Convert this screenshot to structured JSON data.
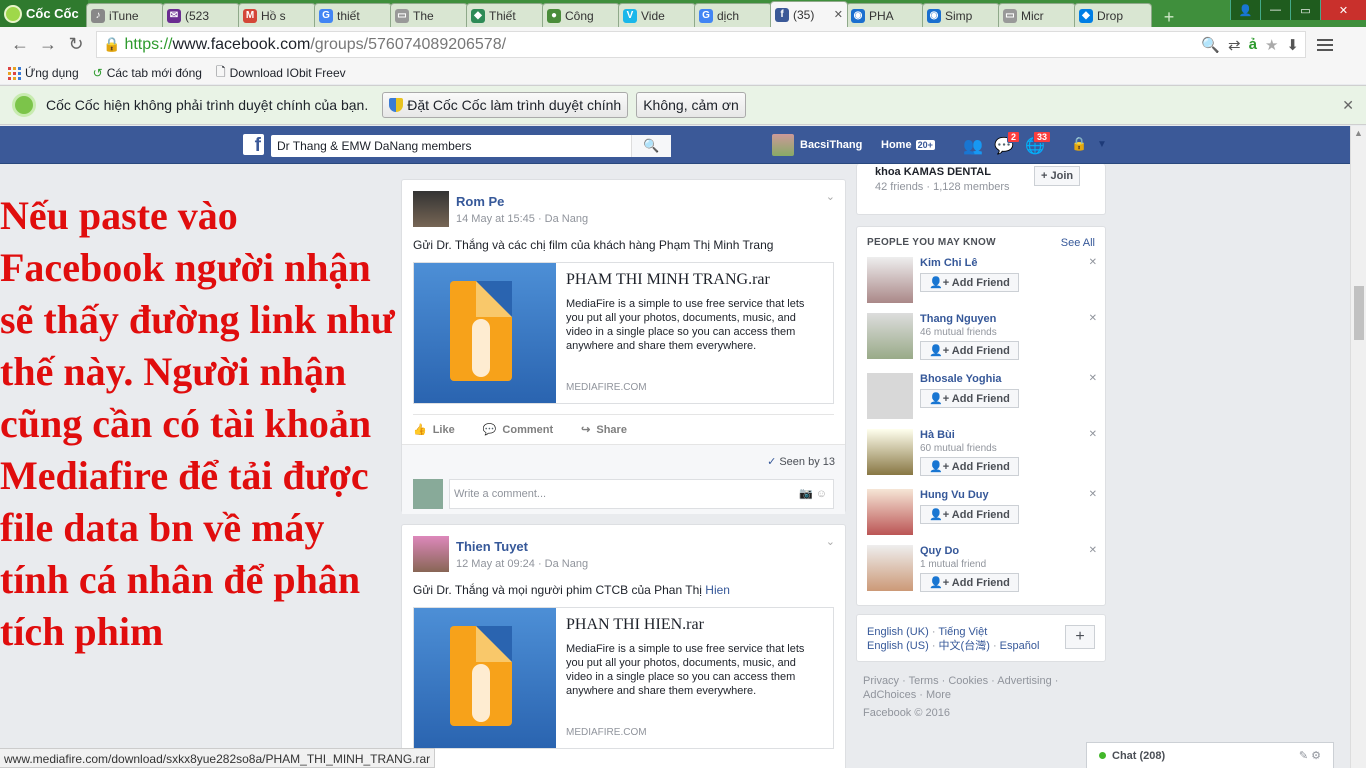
{
  "browser": {
    "brand": "Cốc Cốc",
    "tabs": [
      {
        "title": "iTune",
        "color": "#888888",
        "glyph": "♪"
      },
      {
        "title": "(523",
        "color": "#6a2c91",
        "glyph": "✉"
      },
      {
        "title": "Hồ s",
        "color": "#d44638",
        "glyph": "M"
      },
      {
        "title": "thiết",
        "color": "#4285f4",
        "glyph": "G"
      },
      {
        "title": "The",
        "color": "#999999",
        "glyph": "▭"
      },
      {
        "title": "Thiết",
        "color": "#2e8b57",
        "glyph": "◆"
      },
      {
        "title": "Công",
        "color": "#4a8c3a",
        "glyph": "●"
      },
      {
        "title": "Vide",
        "color": "#1ab7ea",
        "glyph": "V"
      },
      {
        "title": "dịch",
        "color": "#4285f4",
        "glyph": "G"
      },
      {
        "title": "(35)",
        "color": "#3b5998",
        "glyph": "f",
        "active": true
      },
      {
        "title": "PHA",
        "color": "#1a6fcf",
        "glyph": "◉"
      },
      {
        "title": "Simp",
        "color": "#1a6fcf",
        "glyph": "◉"
      },
      {
        "title": "Micr",
        "color": "#999999",
        "glyph": "▭"
      },
      {
        "title": "Drop",
        "color": "#007ee5",
        "glyph": "◆"
      }
    ],
    "url_scheme": "https://",
    "url_host": "www.facebook.com",
    "url_path": "/groups/576074089206578/",
    "bookmarks": [
      "Ứng dụng",
      "Các tab mới đóng",
      "Download IObit Freev"
    ],
    "infobar_text": "Cốc Cốc hiện không phải trình duyệt chính của bạn.",
    "infobar_btn_default": "Đặt Cốc Cốc làm trình duyệt chính",
    "infobar_btn_no": "Không, cảm ơn",
    "status_url": "www.mediafire.com/download/sxkx8yue282so8a/PHAM_THI_MINH_TRANG.rar"
  },
  "fb": {
    "search_value": "Dr Thang & EMW DaNang members",
    "user_name": "BacsiThang",
    "home_label": "Home",
    "home_badge": "20+",
    "msg_badge": "2",
    "notif_badge": "33"
  },
  "overlay_text": "Nếu paste vào Facebook người nhận sẽ thấy đường link như thế này. Người nhận cũng cần có tài khoản Mediafire để tải được file data bn về máy tính cá nhân để phân tích phim",
  "posts": [
    {
      "author": "Rom Pe",
      "date": "14 May at 15:45",
      "place": "Da Nang",
      "text": "Gửi Dr. Thắng và các chị film của khách hàng Phạm Thị Minh Trang",
      "text_link": "",
      "attach_title": "PHAM THI MINH TRANG.rar",
      "attach_desc": "MediaFire is a simple to use free service that lets you put all your photos, documents, music, and video in a single place so you can access them anywhere and share them everywhere.",
      "attach_domain": "MEDIAFIRE.COM"
    },
    {
      "author": "Thien Tuyet",
      "date": "12 May at 09:24",
      "place": "Da Nang",
      "text": "Gửi Dr. Thắng và mọi người phim CTCB của Phan Thị ",
      "text_link": "Hien",
      "attach_title": "PHAN THI HIEN.rar",
      "attach_desc": "MediaFire is a simple to use free service that lets you put all your photos, documents, music, and video in a single place so you can access them anywhere and share them everywhere.",
      "attach_domain": "MEDIAFIRE.COM"
    }
  ],
  "actions": {
    "like": "Like",
    "comment": "Comment",
    "share": "Share",
    "seen": "Seen by 13",
    "comment_placeholder": "Write a comment..."
  },
  "group_suggest": {
    "name": "khoa KAMAS DENTAL",
    "meta": "42 friends · 1,128 members",
    "join": "Join"
  },
  "pymk": {
    "title": "PEOPLE YOU MAY KNOW",
    "see_all": "See All",
    "add_label": "Add Friend",
    "people": [
      {
        "name": "Kim Chi Lê",
        "mutual": ""
      },
      {
        "name": "Thang Nguyen",
        "mutual": "46 mutual friends"
      },
      {
        "name": "Bhosale Yoghia",
        "mutual": ""
      },
      {
        "name": "Hà Bùi",
        "mutual": "60 mutual friends"
      },
      {
        "name": "Hung Vu Duy",
        "mutual": ""
      },
      {
        "name": "Quy Do",
        "mutual": "1 mutual friend"
      }
    ]
  },
  "languages": {
    "l1": "English (UK)",
    "l2": "Tiếng Việt",
    "l3": "English (US)",
    "l4": "中文(台灣)",
    "l5": "Español"
  },
  "footer": {
    "links": "Privacy · Terms · Cookies · Advertising · AdChoices · More",
    "copyright": "Facebook © 2016"
  },
  "chat": {
    "label": "Chat (208)"
  }
}
